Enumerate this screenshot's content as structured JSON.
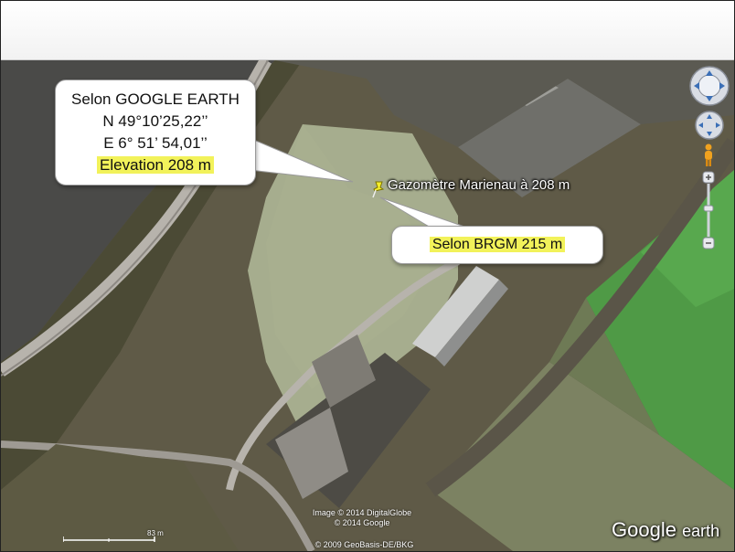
{
  "callout_main": {
    "line1": "Selon GOOGLE EARTH",
    "line2": "N 49°10’25,22’’",
    "line3": "E 6° 51’ 54,01’’",
    "line4": "Elevation  208 m"
  },
  "callout_brgm": {
    "text": "Selon BRGM  215 m"
  },
  "placemark": {
    "label": "Gazomètre Marienau à  208 m",
    "icon": "yellow-pushpin-icon"
  },
  "credits": {
    "line1": "Image © 2014 DigitalGlobe",
    "line2": "© 2014 Google",
    "line3": "© 2009 GeoBasis-DE/BKG"
  },
  "scale": {
    "label": "83  m"
  },
  "logo": {
    "brand": "Google",
    "product": "earth"
  },
  "colors": {
    "highlight": "#f2f25a",
    "field": "#a6ad8e",
    "green": "#4f9a46",
    "road": "#b7b3ac"
  }
}
